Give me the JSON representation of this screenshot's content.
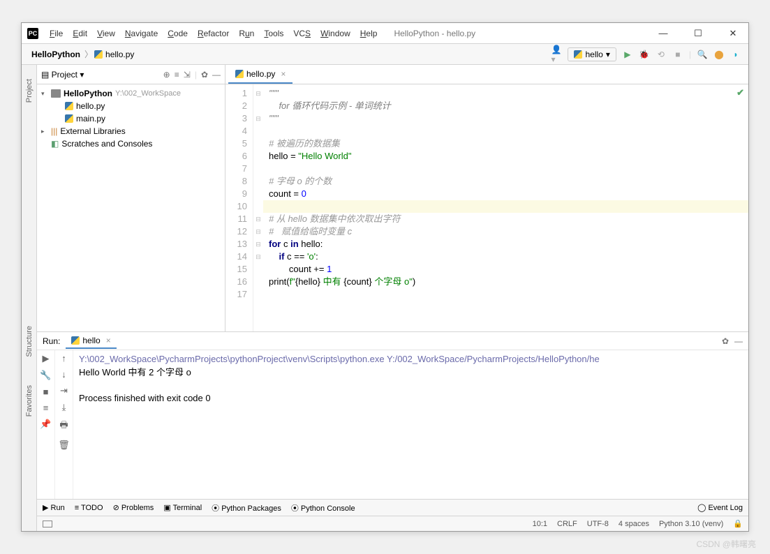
{
  "title": "HelloPython - hello.py",
  "menu": [
    "File",
    "Edit",
    "View",
    "Navigate",
    "Code",
    "Refactor",
    "Run",
    "Tools",
    "VCS",
    "Window",
    "Help"
  ],
  "breadcrumb": {
    "project": "HelloPython",
    "file": "hello.py"
  },
  "run_config": "hello",
  "project": {
    "label": "Project",
    "root": {
      "name": "HelloPython",
      "path": "Y:\\002_WorkSpace"
    },
    "files": [
      "hello.py",
      "main.py"
    ],
    "external": "External Libraries",
    "scratches": "Scratches and Consoles"
  },
  "tab": {
    "name": "hello.py"
  },
  "code": {
    "lines": [
      {
        "n": 1,
        "type": "doc",
        "text": "\"\"\"",
        "fold": "⊟"
      },
      {
        "n": 2,
        "type": "doc",
        "text": "    for 循环代码示例 - 单词统计"
      },
      {
        "n": 3,
        "type": "doc",
        "text": "\"\"\"",
        "fold": "⊟"
      },
      {
        "n": 4,
        "type": "blank",
        "text": ""
      },
      {
        "n": 5,
        "type": "cmt",
        "text": "# 被遍历的数据集"
      },
      {
        "n": 6,
        "type": "code",
        "text": "hello = \"Hello World\""
      },
      {
        "n": 7,
        "type": "blank",
        "text": ""
      },
      {
        "n": 8,
        "type": "cmt",
        "text": "# 字母 o 的个数"
      },
      {
        "n": 9,
        "type": "code",
        "text": "count = 0"
      },
      {
        "n": 10,
        "type": "hl",
        "text": ""
      },
      {
        "n": 11,
        "type": "cmt",
        "text": "# 从 hello 数据集中依次取出字符",
        "fold": "⊟"
      },
      {
        "n": 12,
        "type": "cmt",
        "text": "#   赋值给临时变量 c",
        "fold": "⊟"
      },
      {
        "n": 13,
        "type": "for",
        "text": "for c in hello:",
        "fold": "⊟"
      },
      {
        "n": 14,
        "type": "if",
        "text": "    if c == 'o':",
        "fold": "⊟"
      },
      {
        "n": 15,
        "type": "assign",
        "text": "        count += 1"
      },
      {
        "n": 16,
        "type": "print",
        "text": "print(f\"{hello} 中有 {count} 个字母 o\")"
      },
      {
        "n": 17,
        "type": "blank",
        "text": ""
      }
    ]
  },
  "run": {
    "title": "Run:",
    "tab": "hello",
    "output": {
      "path": "Y:\\002_WorkSpace\\PycharmProjects\\pythonProject\\venv\\Scripts\\python.exe Y:/002_WorkSpace/PycharmProjects/HelloPython/he",
      "line1": "Hello World 中有 2 个字母 o",
      "exit": "Process finished with exit code 0"
    }
  },
  "bottom_tabs": [
    "Run",
    "TODO",
    "Problems",
    "Terminal",
    "Python Packages",
    "Python Console"
  ],
  "event_log": "Event Log",
  "status": {
    "pos": "10:1",
    "eol": "CRLF",
    "enc": "UTF-8",
    "indent": "4 spaces",
    "interp": "Python 3.10 (venv)"
  },
  "gutters": [
    "Project",
    "Structure",
    "Favorites"
  ],
  "watermark": "CSDN @韩曙亮"
}
